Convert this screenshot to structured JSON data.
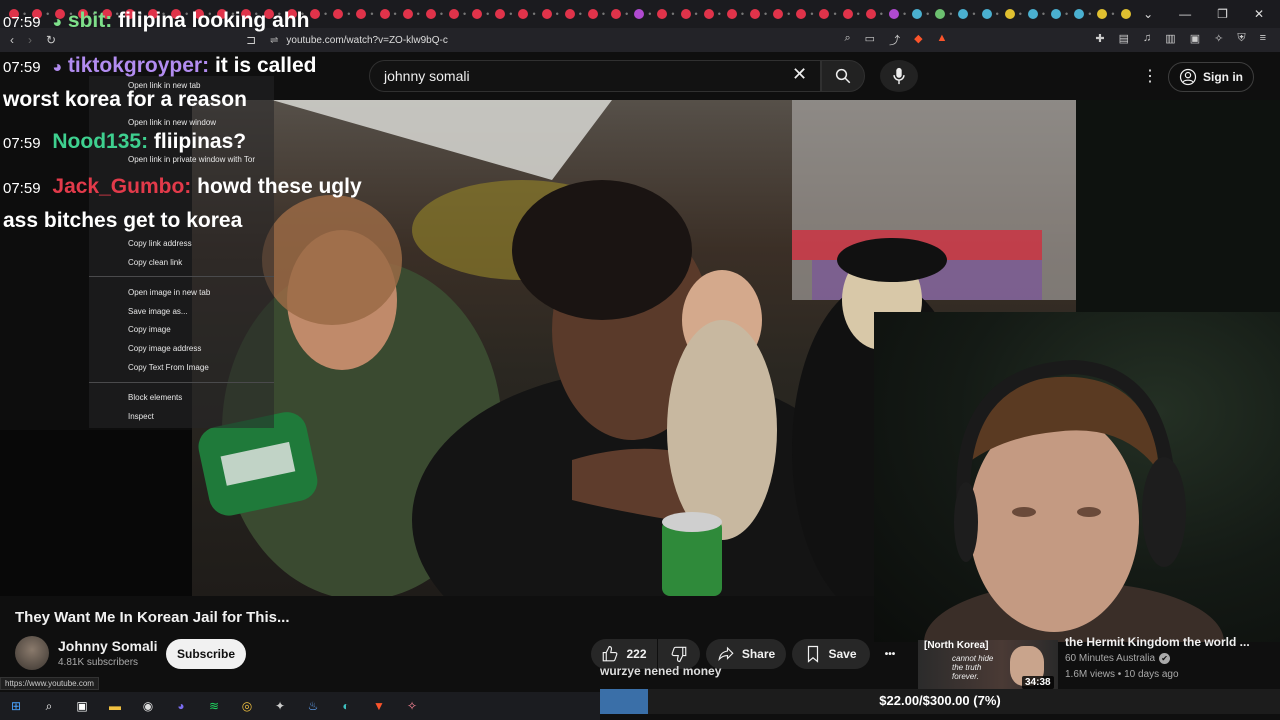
{
  "browser": {
    "tabs": [
      {
        "color": "#e0334a"
      },
      {
        "color": "#e0334a"
      },
      {
        "color": "#e0334a"
      },
      {
        "color": "#e0334a"
      },
      {
        "color": "#e0334a"
      },
      {
        "color": "#e0334a"
      },
      {
        "color": "#e0334a"
      },
      {
        "color": "#e0334a"
      },
      {
        "color": "#e0334a"
      },
      {
        "color": "#e0334a"
      },
      {
        "color": "#e0334a"
      },
      {
        "color": "#e0334a"
      },
      {
        "color": "#e0334a"
      },
      {
        "color": "#e0334a"
      },
      {
        "color": "#e0334a"
      },
      {
        "color": "#e0334a"
      },
      {
        "color": "#e0334a"
      },
      {
        "color": "#e0334a"
      },
      {
        "color": "#e0334a"
      },
      {
        "color": "#e0334a"
      },
      {
        "color": "#e0334a"
      },
      {
        "color": "#e0334a"
      },
      {
        "color": "#e0334a"
      },
      {
        "color": "#e0334a"
      },
      {
        "color": "#e0334a"
      },
      {
        "color": "#e0334a"
      },
      {
        "color": "#e0334a"
      },
      {
        "color": "#b04ad0"
      },
      {
        "color": "#e0334a"
      },
      {
        "color": "#e0334a"
      },
      {
        "color": "#e0334a"
      },
      {
        "color": "#e0334a"
      },
      {
        "color": "#e0334a"
      },
      {
        "color": "#e0334a"
      },
      {
        "color": "#e0334a"
      },
      {
        "color": "#e0334a"
      },
      {
        "color": "#e0334a"
      },
      {
        "color": "#e0334a"
      },
      {
        "color": "#b04ad0"
      },
      {
        "color": "#4ab0d0"
      },
      {
        "color": "#6cc070"
      },
      {
        "color": "#4ab0d0"
      },
      {
        "color": "#4ab0d0"
      },
      {
        "color": "#e0c030"
      },
      {
        "color": "#4ab0d0"
      },
      {
        "color": "#4ab0d0"
      },
      {
        "color": "#4ab0d0"
      },
      {
        "color": "#e0c030"
      },
      {
        "color": "#e0c030"
      },
      {
        "color": "#4ab0d0"
      },
      {
        "color": "#4ab0d0"
      },
      {
        "color": "#e0c030"
      },
      {
        "color": "#4ab0d0"
      },
      {
        "color": "#3b8ee0"
      },
      {
        "color": "#4ab0d0"
      },
      {
        "color": "#4ab0d0"
      },
      {
        "color": "#dddddd"
      }
    ],
    "new_tab_glyph": "+",
    "window_controls": {
      "down": "⌄",
      "minimize": "—",
      "restore": "❐",
      "close": "✕"
    },
    "url": "youtube.com/watch?v=ZO-klw9bQ-c",
    "status_url": "https://www.youtube.com"
  },
  "youtube": {
    "search_value": "johnny somali",
    "sign_in": "Sign in",
    "video_title": "They Want Me In Korean Jail for This...",
    "channel_name": "Johnny Somali",
    "subscribers": "4.81K subscribers",
    "subscribe": "Subscribe",
    "likes": "222",
    "share": "Share",
    "save": "Save",
    "more": "•••"
  },
  "recommended": {
    "title": "the Hermit Kingdom the world ...",
    "channel": "60 Minutes Australia",
    "verified_glyph": "✔",
    "stats": "1.6M views • 10 days ago",
    "duration": "34:38",
    "thumb_heading": "[North Korea]",
    "thumb_text": [
      "cannot hide",
      "the truth",
      "forever."
    ]
  },
  "chat": [
    {
      "time": "07:59",
      "user": "sbit:",
      "user_color": "#7ee08a",
      "message": "filipina looking ahh",
      "cont": ""
    },
    {
      "time": "07:59",
      "user": "tiktokgroyper:",
      "user_color": "#b28cf0",
      "message": "it is called",
      "cont": "worst korea for a reason"
    },
    {
      "time": "07:59",
      "user": "Nood135:",
      "user_color": "#3ed08f",
      "message": "fliipinas?",
      "cont": ""
    },
    {
      "time": "07:59",
      "user": "Jack_Gumbo:",
      "user_color": "#e23a4a",
      "message": "howd these ugly",
      "cont": "ass bitches get to korea"
    }
  ],
  "context_menu": {
    "items": [
      "Open link in new tab",
      "Open link in new window",
      "Open link in private window with Tor",
      "Copy link address",
      "Copy clean link",
      "Open image in new tab",
      "Save image as...",
      "Copy image",
      "Copy image address",
      "Copy Text From Image",
      "Block elements",
      "Inspect"
    ]
  },
  "stream_overlay": {
    "donation_message": "wurzye nened money",
    "goal_text": "$22.00/$300.00 (7%)",
    "goal_progress": 0.07
  },
  "taskbar": {
    "icons": [
      {
        "name": "windows-start-icon",
        "glyph": "⊞",
        "color": "#4aa3ff"
      },
      {
        "name": "search-icon",
        "glyph": "⌕",
        "color": "#ffffff"
      },
      {
        "name": "task-view-icon",
        "glyph": "▣",
        "color": "#ffffff"
      },
      {
        "name": "file-explorer-icon",
        "glyph": "▬",
        "color": "#f0c040"
      },
      {
        "name": "obs-icon",
        "glyph": "◉",
        "color": "#dddddd"
      },
      {
        "name": "discord-icon",
        "glyph": "◕",
        "color": "#7a6cf0"
      },
      {
        "name": "spotify-icon",
        "glyph": "≋",
        "color": "#1ed760"
      },
      {
        "name": "chrome-icon",
        "glyph": "◎",
        "color": "#f0c040"
      },
      {
        "name": "app-icon",
        "glyph": "✦",
        "color": "#cccccc"
      },
      {
        "name": "steam-icon",
        "glyph": "♨",
        "color": "#66aaff"
      },
      {
        "name": "edge-icon",
        "glyph": "◐",
        "color": "#3ec0c0"
      },
      {
        "name": "brave-icon",
        "glyph": "▼",
        "color": "#fb542b"
      },
      {
        "name": "app-icon-2",
        "glyph": "✧",
        "color": "#ff8899"
      }
    ]
  }
}
